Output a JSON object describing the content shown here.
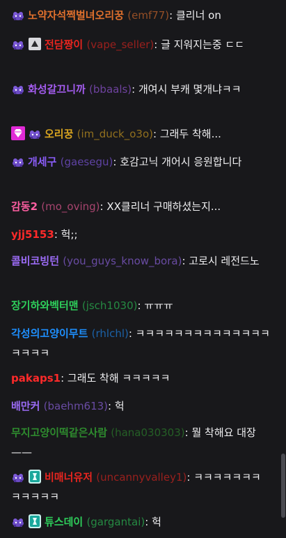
{
  "colors": {
    "background": "#18181b",
    "message_text": "#efeff1",
    "scrollbar": "#4a4a50"
  },
  "messages": [
    {
      "badges": [
        "purple-creature-icon"
      ],
      "nick": "노약자석쩍벌녀오리꿍",
      "login": "(emf77)",
      "sep": ": ",
      "text": "클리너 on",
      "color": "#e0702d"
    },
    {
      "badges": [
        "purple-creature-icon",
        "arrow-up-box-icon"
      ],
      "nick": "전담짱이",
      "login": "(vape_seller)",
      "sep": ": ",
      "text": "글 지워지는중 ㄷㄷ",
      "color": "#e8251f"
    },
    {
      "badges": [
        "purple-creature-icon"
      ],
      "nick": "화성갈끄니까",
      "login": "(bbaals)",
      "sep": ": ",
      "text": "개여시 부캐 몇개냐ㅋㅋ",
      "color": "#a45cf0"
    },
    {
      "badges": [
        "pink-diamond-icon",
        "purple-creature-icon"
      ],
      "nick": "오리꿍",
      "login": "(im_duck_o3o)",
      "sep": ": ",
      "text": "그래두 착해...",
      "color": "#daa520"
    },
    {
      "badges": [
        "purple-creature-icon"
      ],
      "nick": "개세구",
      "login": "(gaesegu)",
      "sep": ": ",
      "text": "호감고닉 개어시 응원합니다",
      "color": "#8a5cf7"
    },
    {
      "badges": [],
      "nick": "감동2",
      "login": "(mo_oving)",
      "sep": ": ",
      "text": "XX클리너 구매하셨는지...",
      "color": "#ff5fa2"
    },
    {
      "badges": [],
      "nick": "yjj5153",
      "login": "",
      "sep": ": ",
      "text": "헉;;",
      "color": "#ff2a2a"
    },
    {
      "badges": [],
      "nick": "콜비코빙턴",
      "login": "(you_guys_know_bora)",
      "sep": ": ",
      "text": "고로시 레전드노",
      "color": "#9b6bf6"
    },
    {
      "badges": [],
      "nick": "장기하와벡터맨",
      "login": "(jsch1030)",
      "sep": ": ",
      "text": "ㅠㅠㅠ",
      "color": "#2ecf5b"
    },
    {
      "badges": [],
      "nick": "각성의고양이무트",
      "login": "(rhlchl)",
      "sep": ": ",
      "text": "ㅋㅋㅋㅋㅋㅋㅋㅋㅋㅋㅋㅋㅋㅋㅋㅋㅋㅋ",
      "color": "#1e90ff"
    },
    {
      "badges": [],
      "nick": "pakaps1",
      "login": "",
      "sep": ": ",
      "text": "그래도 착해 ㅋㅋㅋㅋㅋ",
      "color": "#ff2a2a"
    },
    {
      "badges": [],
      "nick": "배만커",
      "login": "(baehm613)",
      "sep": ": ",
      "text": "헉",
      "color": "#9b6bf6"
    },
    {
      "badges": [],
      "nick": "무지고양이떡같은사람",
      "login": "(hana030303)",
      "sep": ": ",
      "text": "뭘 착해요 대장 ——",
      "color": "#2e8b2e"
    },
    {
      "badges": [
        "purple-creature-icon",
        "teal-sub-icon"
      ],
      "nick": "비매너유저",
      "login": "(uncannyvalley1)",
      "sep": ": ",
      "text": "ㅋㅋㅋㅋㅋㅋㅋㅋㅋㅋㅋㅋ",
      "color": "#e8251f"
    },
    {
      "badges": [
        "purple-creature-icon",
        "teal-sub-icon"
      ],
      "nick": "튜스데이",
      "login": "(gargantai)",
      "sep": ": ",
      "text": "헉",
      "color": "#2ecf5b"
    }
  ]
}
